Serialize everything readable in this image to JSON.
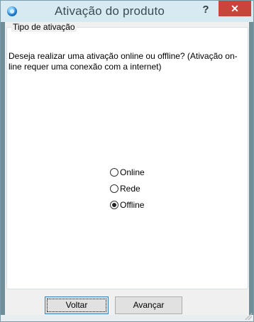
{
  "window": {
    "title": "Ativação do produto",
    "help_label": "?",
    "close_label": "✕"
  },
  "group": {
    "legend": "Tipo de ativação",
    "question": "Deseja realizar uma ativação online ou offline? (Ativação on-line requer uma conexão com a internet)"
  },
  "options": [
    {
      "label": "Online",
      "checked": false
    },
    {
      "label": "Rede",
      "checked": false
    },
    {
      "label": "Offline",
      "checked": true
    }
  ],
  "buttons": {
    "back": "Voltar",
    "next": "Avançar"
  },
  "colors": {
    "close": "#c9453b",
    "titlebar": "#d7eaf1"
  }
}
